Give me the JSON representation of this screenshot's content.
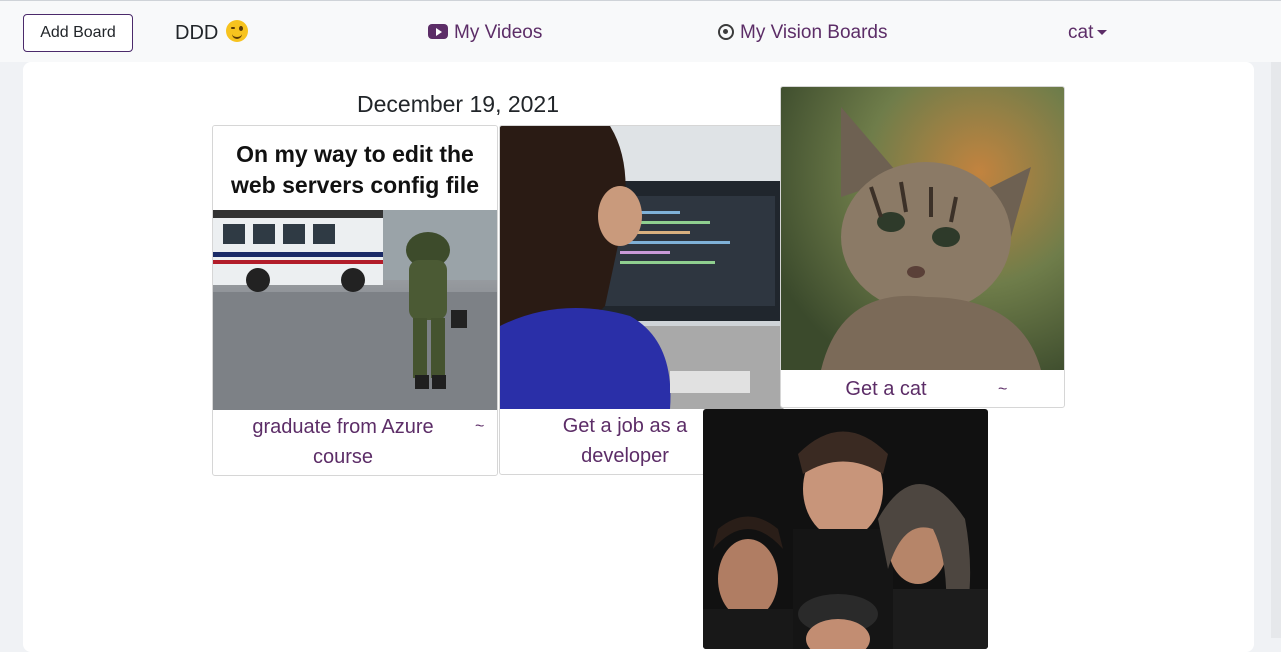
{
  "navbar": {
    "add_board_label": "Add Board",
    "brand_text": "DDD",
    "brand_emoji": "winking-face-icon",
    "videos_label": "My Videos",
    "vision_boards_label": "My Vision Boards",
    "user_menu_label": "cat"
  },
  "board": {
    "date": "December 19, 2021",
    "cards": [
      {
        "caption": "graduate from Azure course",
        "image_text": "On my way to edit the web servers config file",
        "marker": "~"
      },
      {
        "caption": "Get a job as a developer",
        "marker": ""
      },
      {
        "caption": "Get a cat",
        "marker": "~"
      },
      {
        "caption": "",
        "marker": ""
      }
    ]
  },
  "colors": {
    "accent": "#5c2d67",
    "navbar_bg": "#f8f9fa",
    "page_bg": "#f0f2f5"
  }
}
